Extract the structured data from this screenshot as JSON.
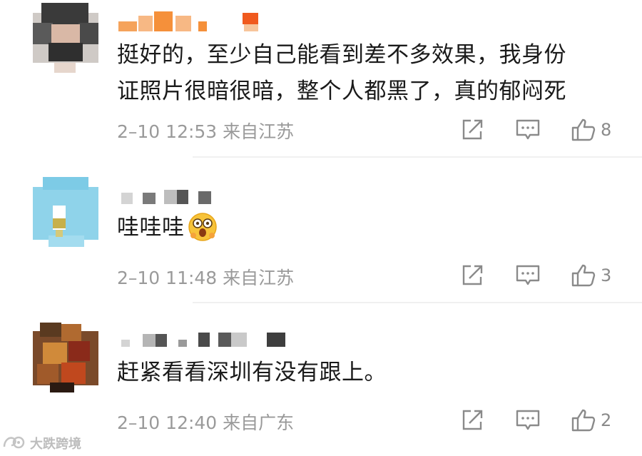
{
  "comments": [
    {
      "text_lines": [
        "挺好的，至少自己能看到差不多效果，我身份",
        "证照片很暗很暗，整个人都黑了，真的郁闷死"
      ],
      "date": "2–10",
      "time": "12:53",
      "location": "来自江苏",
      "likes": "8"
    },
    {
      "text_lines": [
        "哇哇哇"
      ],
      "emoji": "astonished-face-emoji",
      "date": "2–10",
      "time": "11:48",
      "location": "来自江苏",
      "likes": "3"
    },
    {
      "text_lines": [
        "赶紧看看深圳有没有跟上。"
      ],
      "date": "2–10",
      "time": "12:40",
      "location": "来自广东",
      "likes": "2"
    }
  ],
  "icons": {
    "share": "share-icon",
    "comment": "comment-icon",
    "like": "thumbs-up-icon"
  },
  "watermark": {
    "text": "大跌跨境",
    "icon": "watermark-logo-icon"
  },
  "colors": {
    "text": "#1a1a1a",
    "meta": "#9a9a9a",
    "username_orange": "#f5903a"
  }
}
